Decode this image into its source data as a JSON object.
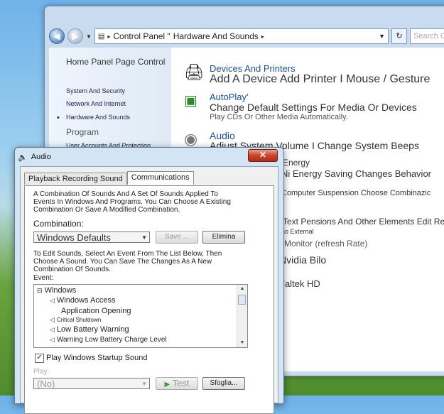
{
  "control_panel": {
    "breadcrumb": [
      "Control Panel \"",
      "Hardware And Sounds"
    ],
    "search_placeholder": "Search Control Panel",
    "sidebar": {
      "home": "Home Panel Page Control",
      "items": [
        "System And Security",
        "Network And Internet",
        "Hardware And Sounds",
        "User Accounts And Protection"
      ],
      "programs": "Program"
    },
    "categories": {
      "devices_title": "Devices And Printers",
      "devices_desc": "Add A Device Add Printer I Mouse / Gesture",
      "autoplay_title": "AutoPlay'",
      "autoplay_desc": "Change Default Settings For Media Or Devices",
      "autoplay_sub": "Play CDs Or Other Media Automatically.",
      "audio_title": "Audio",
      "audio_desc": "Adjust System Volume I Change System Beeps",
      "energy_title": "Energy",
      "energy_desc": "Ni Energy Saving Changes Behavior",
      "energy_sub": "Computer Suspension Choose Combinazic",
      "display_desc": "Text Pensions And Other Elements Edit Resolu",
      "display_sub": "no External",
      "display_sub2": "Monitor (refresh Rate)",
      "nvidia": "Nvidia Bilo",
      "realtek": "Faltek HD"
    }
  },
  "dialog": {
    "title": "Audio",
    "close_glyph": "✕",
    "tabs": [
      "Playback Recording Sound",
      "Communications"
    ],
    "intro": "A Combination Of Sounds And A Set Of Sounds Applied To Events In Windows And Programs. You Can Choose A Existing Combination Or Save A Modified Combination.",
    "combination_label": "Combination:",
    "combination_value": "Windows Defaults",
    "save_button": "Save ...",
    "delete_button": "Elimina",
    "instructions": "To Edit Sounds, Select An Event From The List Below, Then Choose A Sound. You Can Save The Changes As A New Combination Of Sounds.",
    "event_label": "Event:",
    "events": [
      "Windows",
      "Windows Access",
      "Application Opening",
      "Critical Shutdown",
      "Low Battery Warning",
      "Warning Low Battery Charge Level"
    ],
    "startup_checkbox": "Play Windows Startup Sound",
    "play_label": "Play:",
    "play_value": "(No)",
    "test_button": "Test",
    "browse_button": "Sfoglia..."
  }
}
